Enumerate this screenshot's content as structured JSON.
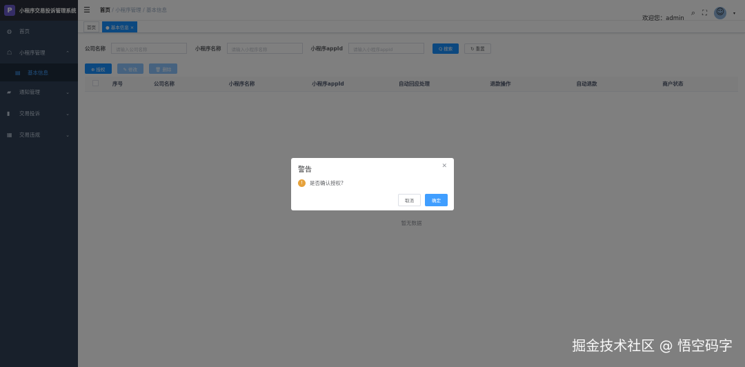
{
  "app": {
    "title": "小程序交易投诉管理系统",
    "logo": "P"
  },
  "sidebar": {
    "items": [
      {
        "label": "首页",
        "icon": "dashboard-icon",
        "glyph": "◍"
      },
      {
        "label": "小程序管理",
        "icon": "app-icon",
        "glyph": "☖",
        "chevron": "⌃"
      },
      {
        "label": "基本信息",
        "icon": "list-icon",
        "glyph": "▤"
      },
      {
        "label": "通知管理",
        "icon": "message-icon",
        "glyph": "▰",
        "chevron": "⌄"
      },
      {
        "label": "交易投诉",
        "icon": "complaint-icon",
        "glyph": "▮",
        "chevron": "⌄"
      },
      {
        "label": "交易违规",
        "icon": "violation-icon",
        "glyph": "▦",
        "chevron": "⌄"
      }
    ]
  },
  "header": {
    "breadcrumb": [
      "首页",
      "小程序管理",
      "基本信息"
    ],
    "separator": "/",
    "welcome": "欢迎您：admin"
  },
  "tags": [
    {
      "label": "首页"
    },
    {
      "label": "● 基本信息 ×"
    }
  ],
  "search": {
    "company_label": "公司名称",
    "company_placeholder": "请输入公司名称",
    "name_label": "小程序名称",
    "name_placeholder": "请输入小程序名称",
    "appid_label": "小程序appId",
    "appid_placeholder": "请输入小程序appId",
    "search_btn": "Q 搜索",
    "reset_btn": "↻ 重置"
  },
  "toolbar": {
    "authorize": "⊕ 授权",
    "edit": "✎ 修改",
    "delete": "🗑 删除"
  },
  "table": {
    "columns": [
      "序号",
      "公司名称",
      "小程序名称",
      "小程序appId",
      "自动回应处理",
      "退款操作",
      "自动退款",
      "商户状态"
    ],
    "empty": "暂无数据"
  },
  "dialog": {
    "title": "警告",
    "message": "是否确认授权?",
    "cancel": "取消",
    "confirm": "确定"
  },
  "watermark": "掘金技术社区 @ 悟空码字"
}
